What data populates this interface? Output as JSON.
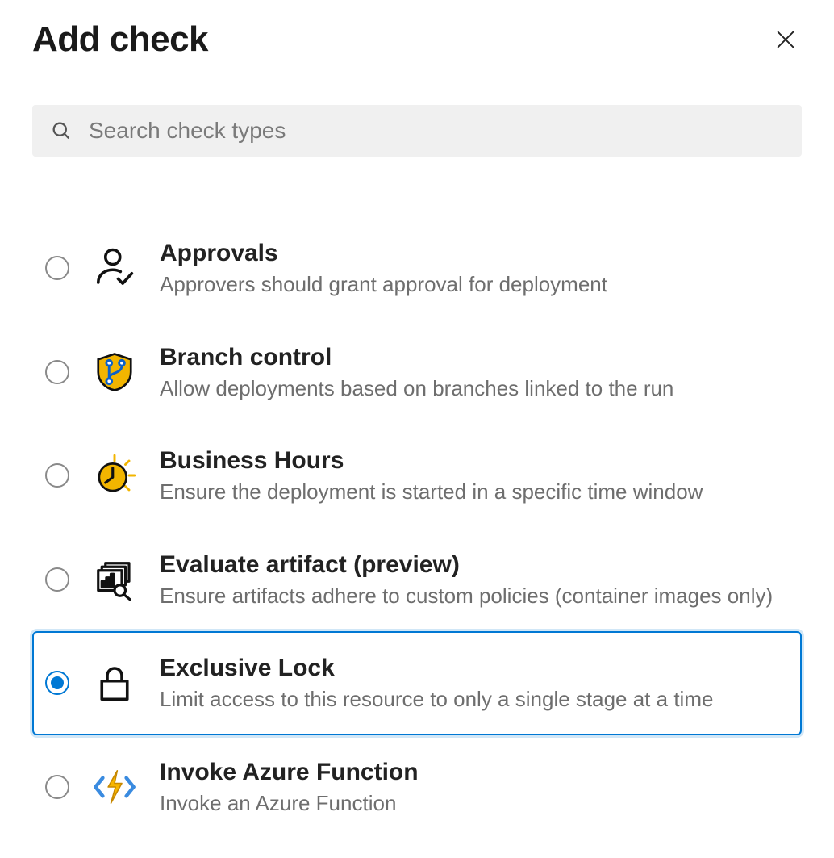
{
  "header": {
    "title": "Add check"
  },
  "search": {
    "placeholder": "Search check types",
    "value": ""
  },
  "selected_index": 4,
  "options": [
    {
      "id": "approvals",
      "icon": "person-check-icon",
      "title": "Approvals",
      "desc": "Approvers should grant approval for deployment"
    },
    {
      "id": "branch-control",
      "icon": "branch-shield-icon",
      "title": "Branch control",
      "desc": "Allow deployments based on branches linked to the run"
    },
    {
      "id": "business-hours",
      "icon": "clock-sun-icon",
      "title": "Business Hours",
      "desc": "Ensure the deployment is started in a specific time window"
    },
    {
      "id": "evaluate-artifact",
      "icon": "artifact-stack-icon",
      "title": "Evaluate artifact (preview)",
      "desc": "Ensure artifacts adhere to custom policies (container images only)"
    },
    {
      "id": "exclusive-lock",
      "icon": "lock-icon",
      "title": "Exclusive Lock",
      "desc": "Limit access to this resource to only a single stage at a time"
    },
    {
      "id": "invoke-azure-function",
      "icon": "azure-function-icon",
      "title": "Invoke Azure Function",
      "desc": "Invoke an Azure Function"
    }
  ]
}
